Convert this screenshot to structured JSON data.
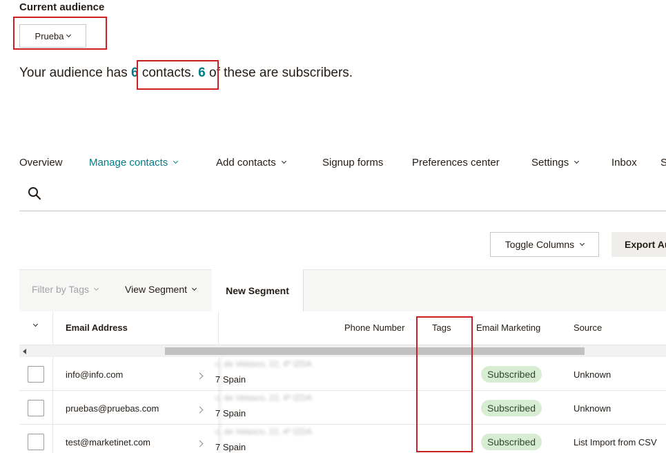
{
  "header": {
    "current_audience_label": "Current audience",
    "audience_select_value": "Prueba",
    "summary": {
      "prefix": "Your audience has ",
      "contacts_count": "6",
      "contacts_word": " contacts.",
      "gap": " ",
      "subscribers_count": "6",
      "suffix": " of these are subscribers."
    }
  },
  "nav": {
    "items": [
      {
        "label": "Overview",
        "dropdown": false,
        "active": false
      },
      {
        "label": "Manage contacts",
        "dropdown": true,
        "active": true
      },
      {
        "label": "Add contacts",
        "dropdown": true,
        "active": false
      },
      {
        "label": "Signup forms",
        "dropdown": false,
        "active": false
      },
      {
        "label": "Preferences center",
        "dropdown": false,
        "active": false
      },
      {
        "label": "Settings",
        "dropdown": true,
        "active": false
      },
      {
        "label": "Inbox",
        "dropdown": false,
        "active": false
      },
      {
        "label": "S",
        "dropdown": false,
        "active": false
      }
    ]
  },
  "search": {
    "icon": "search-icon"
  },
  "toolbar": {
    "toggle_columns_label": "Toggle Columns",
    "export_label": "Export Au"
  },
  "filters": {
    "filter_by_tags_label": "Filter by Tags",
    "view_segment_label": "View Segment",
    "new_segment_label": "New Segment"
  },
  "table": {
    "columns": [
      "Email Address",
      "Phone Number",
      "Tags",
      "Email Marketing",
      "Source"
    ],
    "rows": [
      {
        "email": "info@info.com",
        "address_line1": "c. de Velasco, 22, 4º IZDA",
        "address_line2": "7 Spain",
        "tags": "",
        "status": "Subscribed",
        "source": "Unknown"
      },
      {
        "email": "pruebas@pruebas.com",
        "address_line1": "c. de Velasco, 22, 4º IZDA",
        "address_line2": "7 Spain",
        "tags": "",
        "status": "Subscribed",
        "source": "Unknown"
      },
      {
        "email": "test@marketinet.com",
        "address_line1": "c. de Velasco, 22, 4º IZDA",
        "address_line2": "7 Spain",
        "tags": "",
        "status": "Subscribed",
        "source": "List Import from CSV"
      }
    ]
  },
  "colors": {
    "accent": "#007c89",
    "highlight_box": "#cc1f1f",
    "badge_bg": "#d8ecd3"
  }
}
